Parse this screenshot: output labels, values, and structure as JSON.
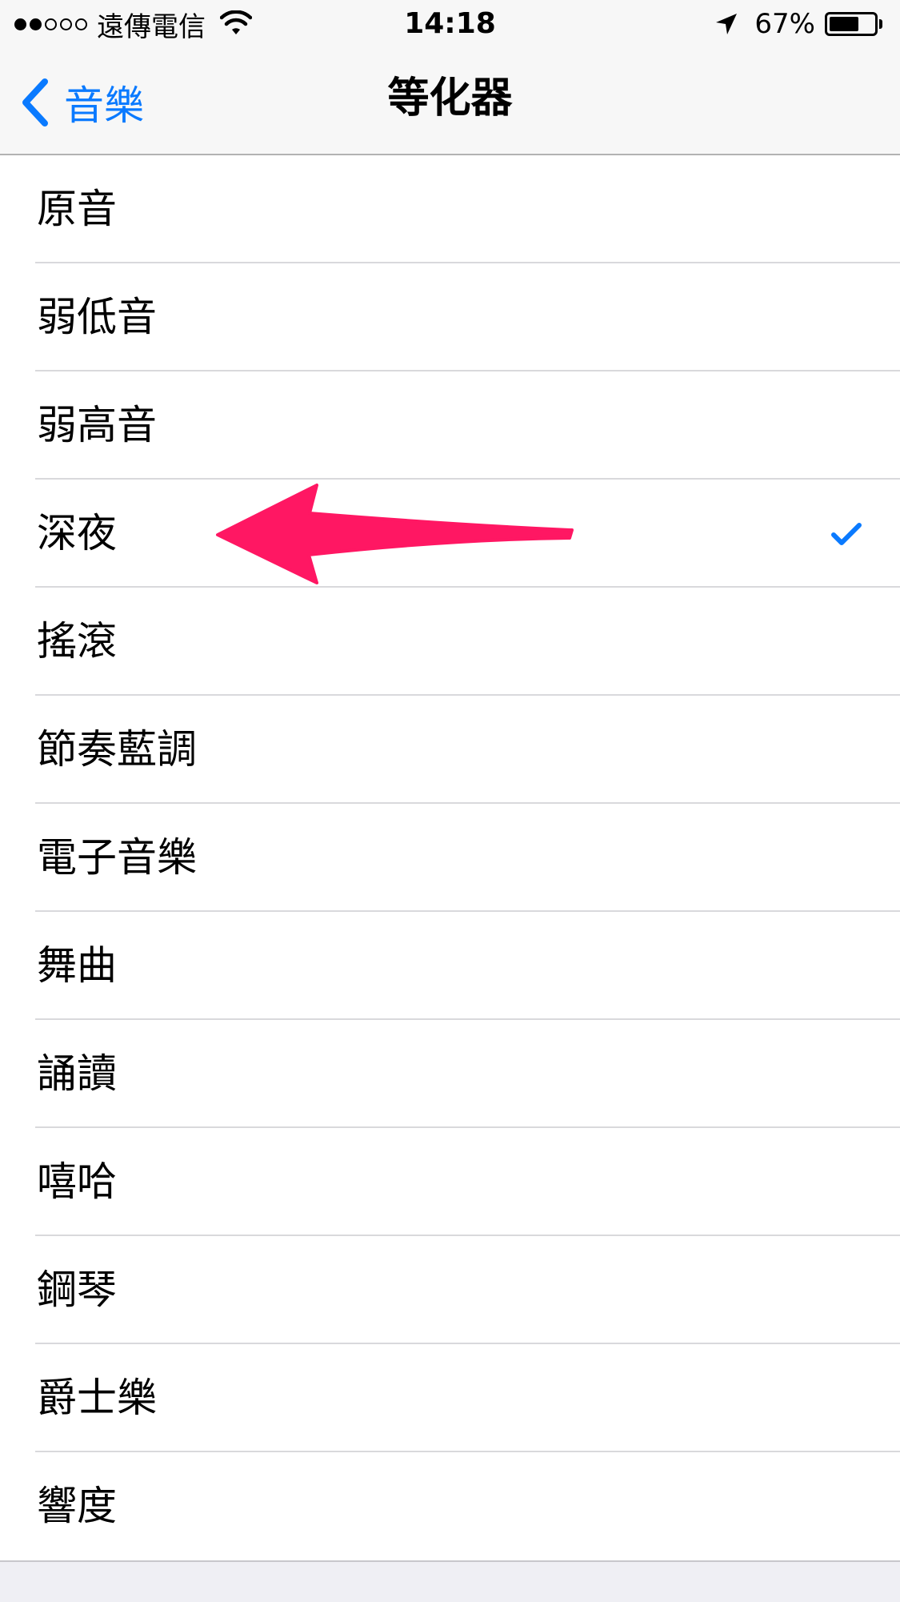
{
  "status_bar": {
    "signal_filled": 2,
    "signal_total": 5,
    "carrier": "遠傳電信",
    "time": "14:18",
    "battery_text": "67%",
    "battery_level": 0.67
  },
  "nav": {
    "back_label": "音樂",
    "title": "等化器"
  },
  "equalizer": {
    "selected": "深夜",
    "items": [
      {
        "label": "原音"
      },
      {
        "label": "弱低音"
      },
      {
        "label": "弱高音"
      },
      {
        "label": "深夜"
      },
      {
        "label": "搖滾"
      },
      {
        "label": "節奏藍調"
      },
      {
        "label": "電子音樂"
      },
      {
        "label": "舞曲"
      },
      {
        "label": "誦讀"
      },
      {
        "label": "嘻哈"
      },
      {
        "label": "鋼琴"
      },
      {
        "label": "爵士樂"
      },
      {
        "label": "響度"
      }
    ]
  },
  "colors": {
    "accent": "#0a7aff",
    "annotation_arrow": "#ff1763"
  },
  "icons": {
    "back": "chevron-left-icon",
    "check": "checkmark-icon",
    "wifi": "wifi-icon",
    "location": "location-arrow-icon",
    "battery": "battery-icon",
    "annotation": "pink-arrow-annotation"
  }
}
